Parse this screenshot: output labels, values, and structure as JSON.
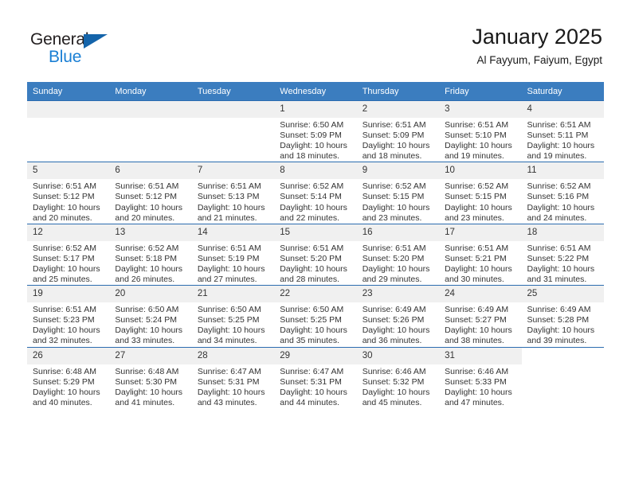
{
  "logo": {
    "word1": "General",
    "word2": "Blue",
    "triangle_color": "#1464aa",
    "word2_color": "#1a7fd4"
  },
  "header": {
    "title": "January 2025",
    "subtitle": "Al Fayyum, Faiyum, Egypt"
  },
  "theme": {
    "header_row_bg": "#3b7dbf",
    "row_divider": "#2b6cb0",
    "daynum_bg": "#f0f0f0",
    "text": "#333333"
  },
  "weekday_headers": [
    "Sunday",
    "Monday",
    "Tuesday",
    "Wednesday",
    "Thursday",
    "Friday",
    "Saturday"
  ],
  "weeks": [
    [
      {
        "day": "",
        "lines": []
      },
      {
        "day": "",
        "lines": []
      },
      {
        "day": "",
        "lines": []
      },
      {
        "day": "1",
        "lines": [
          "Sunrise: 6:50 AM",
          "Sunset: 5:09 PM",
          "Daylight: 10 hours",
          "and 18 minutes."
        ]
      },
      {
        "day": "2",
        "lines": [
          "Sunrise: 6:51 AM",
          "Sunset: 5:09 PM",
          "Daylight: 10 hours",
          "and 18 minutes."
        ]
      },
      {
        "day": "3",
        "lines": [
          "Sunrise: 6:51 AM",
          "Sunset: 5:10 PM",
          "Daylight: 10 hours",
          "and 19 minutes."
        ]
      },
      {
        "day": "4",
        "lines": [
          "Sunrise: 6:51 AM",
          "Sunset: 5:11 PM",
          "Daylight: 10 hours",
          "and 19 minutes."
        ]
      }
    ],
    [
      {
        "day": "5",
        "lines": [
          "Sunrise: 6:51 AM",
          "Sunset: 5:12 PM",
          "Daylight: 10 hours",
          "and 20 minutes."
        ]
      },
      {
        "day": "6",
        "lines": [
          "Sunrise: 6:51 AM",
          "Sunset: 5:12 PM",
          "Daylight: 10 hours",
          "and 20 minutes."
        ]
      },
      {
        "day": "7",
        "lines": [
          "Sunrise: 6:51 AM",
          "Sunset: 5:13 PM",
          "Daylight: 10 hours",
          "and 21 minutes."
        ]
      },
      {
        "day": "8",
        "lines": [
          "Sunrise: 6:52 AM",
          "Sunset: 5:14 PM",
          "Daylight: 10 hours",
          "and 22 minutes."
        ]
      },
      {
        "day": "9",
        "lines": [
          "Sunrise: 6:52 AM",
          "Sunset: 5:15 PM",
          "Daylight: 10 hours",
          "and 23 minutes."
        ]
      },
      {
        "day": "10",
        "lines": [
          "Sunrise: 6:52 AM",
          "Sunset: 5:15 PM",
          "Daylight: 10 hours",
          "and 23 minutes."
        ]
      },
      {
        "day": "11",
        "lines": [
          "Sunrise: 6:52 AM",
          "Sunset: 5:16 PM",
          "Daylight: 10 hours",
          "and 24 minutes."
        ]
      }
    ],
    [
      {
        "day": "12",
        "lines": [
          "Sunrise: 6:52 AM",
          "Sunset: 5:17 PM",
          "Daylight: 10 hours",
          "and 25 minutes."
        ]
      },
      {
        "day": "13",
        "lines": [
          "Sunrise: 6:52 AM",
          "Sunset: 5:18 PM",
          "Daylight: 10 hours",
          "and 26 minutes."
        ]
      },
      {
        "day": "14",
        "lines": [
          "Sunrise: 6:51 AM",
          "Sunset: 5:19 PM",
          "Daylight: 10 hours",
          "and 27 minutes."
        ]
      },
      {
        "day": "15",
        "lines": [
          "Sunrise: 6:51 AM",
          "Sunset: 5:20 PM",
          "Daylight: 10 hours",
          "and 28 minutes."
        ]
      },
      {
        "day": "16",
        "lines": [
          "Sunrise: 6:51 AM",
          "Sunset: 5:20 PM",
          "Daylight: 10 hours",
          "and 29 minutes."
        ]
      },
      {
        "day": "17",
        "lines": [
          "Sunrise: 6:51 AM",
          "Sunset: 5:21 PM",
          "Daylight: 10 hours",
          "and 30 minutes."
        ]
      },
      {
        "day": "18",
        "lines": [
          "Sunrise: 6:51 AM",
          "Sunset: 5:22 PM",
          "Daylight: 10 hours",
          "and 31 minutes."
        ]
      }
    ],
    [
      {
        "day": "19",
        "lines": [
          "Sunrise: 6:51 AM",
          "Sunset: 5:23 PM",
          "Daylight: 10 hours",
          "and 32 minutes."
        ]
      },
      {
        "day": "20",
        "lines": [
          "Sunrise: 6:50 AM",
          "Sunset: 5:24 PM",
          "Daylight: 10 hours",
          "and 33 minutes."
        ]
      },
      {
        "day": "21",
        "lines": [
          "Sunrise: 6:50 AM",
          "Sunset: 5:25 PM",
          "Daylight: 10 hours",
          "and 34 minutes."
        ]
      },
      {
        "day": "22",
        "lines": [
          "Sunrise: 6:50 AM",
          "Sunset: 5:25 PM",
          "Daylight: 10 hours",
          "and 35 minutes."
        ]
      },
      {
        "day": "23",
        "lines": [
          "Sunrise: 6:49 AM",
          "Sunset: 5:26 PM",
          "Daylight: 10 hours",
          "and 36 minutes."
        ]
      },
      {
        "day": "24",
        "lines": [
          "Sunrise: 6:49 AM",
          "Sunset: 5:27 PM",
          "Daylight: 10 hours",
          "and 38 minutes."
        ]
      },
      {
        "day": "25",
        "lines": [
          "Sunrise: 6:49 AM",
          "Sunset: 5:28 PM",
          "Daylight: 10 hours",
          "and 39 minutes."
        ]
      }
    ],
    [
      {
        "day": "26",
        "lines": [
          "Sunrise: 6:48 AM",
          "Sunset: 5:29 PM",
          "Daylight: 10 hours",
          "and 40 minutes."
        ]
      },
      {
        "day": "27",
        "lines": [
          "Sunrise: 6:48 AM",
          "Sunset: 5:30 PM",
          "Daylight: 10 hours",
          "and 41 minutes."
        ]
      },
      {
        "day": "28",
        "lines": [
          "Sunrise: 6:47 AM",
          "Sunset: 5:31 PM",
          "Daylight: 10 hours",
          "and 43 minutes."
        ]
      },
      {
        "day": "29",
        "lines": [
          "Sunrise: 6:47 AM",
          "Sunset: 5:31 PM",
          "Daylight: 10 hours",
          "and 44 minutes."
        ]
      },
      {
        "day": "30",
        "lines": [
          "Sunrise: 6:46 AM",
          "Sunset: 5:32 PM",
          "Daylight: 10 hours",
          "and 45 minutes."
        ]
      },
      {
        "day": "31",
        "lines": [
          "Sunrise: 6:46 AM",
          "Sunset: 5:33 PM",
          "Daylight: 10 hours",
          "and 47 minutes."
        ]
      },
      {
        "day": "",
        "lines": []
      }
    ]
  ]
}
